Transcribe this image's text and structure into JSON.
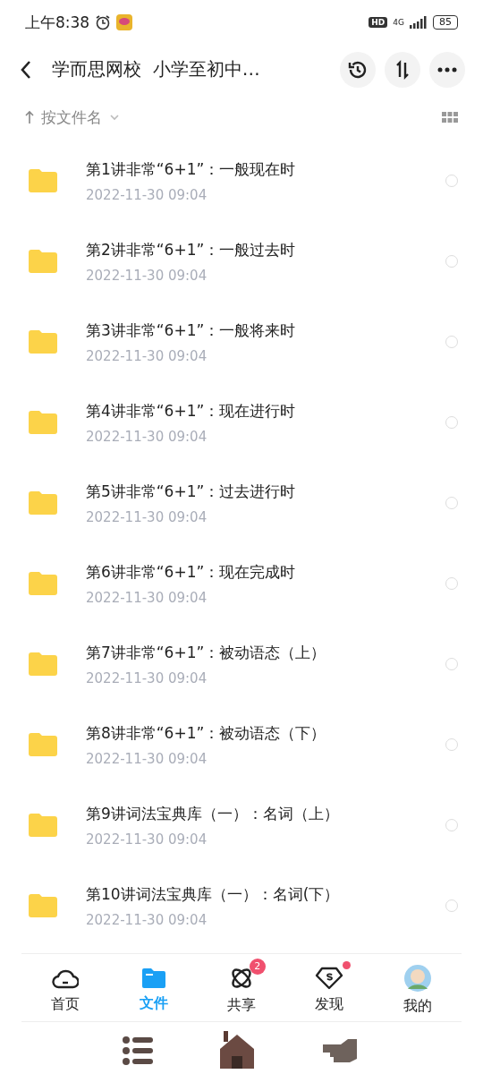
{
  "status_bar": {
    "time": "上午8:38",
    "hd": "HD",
    "network": "4G",
    "battery": "85"
  },
  "header": {
    "title": "学而思网校  小学至初中…"
  },
  "sort": {
    "label": "按文件名"
  },
  "files": [
    {
      "name": "第1讲非常“6+1”：一般现在时",
      "date": "2022-11-30  09:04",
      "selected": false
    },
    {
      "name": "第2讲非常“6+1”：一般过去时",
      "date": "2022-11-30  09:04",
      "selected": false
    },
    {
      "name": "第3讲非常“6+1”：一般将来时",
      "date": "2022-11-30  09:04",
      "selected": false
    },
    {
      "name": "第4讲非常“6+1”：现在进行时",
      "date": "2022-11-30  09:04",
      "selected": false
    },
    {
      "name": "第5讲非常“6+1”：过去进行时",
      "date": "2022-11-30  09:04",
      "selected": false
    },
    {
      "name": "第6讲非常“6+1”：现在完成时",
      "date": "2022-11-30  09:04",
      "selected": false
    },
    {
      "name": "第7讲非常“6+1”：被动语态（上）",
      "date": "2022-11-30  09:04",
      "selected": false
    },
    {
      "name": "第8讲非常“6+1”：被动语态（下）",
      "date": "2022-11-30  09:04",
      "selected": false
    },
    {
      "name": "第9讲词法宝典库（一）：名词（上）",
      "date": "2022-11-30  09:04",
      "selected": false
    },
    {
      "name": "第10讲词法宝典库（一）：名词(下）",
      "date": "2022-11-30  09:04",
      "selected": false
    }
  ],
  "tabs": [
    {
      "kind": "home",
      "label": "首页",
      "selected": false
    },
    {
      "kind": "files",
      "label": "文件",
      "selected": true
    },
    {
      "kind": "share",
      "label": "共享",
      "selected": false,
      "badge": "2"
    },
    {
      "kind": "discover",
      "label": "发现",
      "selected": false,
      "dot": true
    },
    {
      "kind": "me",
      "label": "我的",
      "selected": false
    }
  ]
}
